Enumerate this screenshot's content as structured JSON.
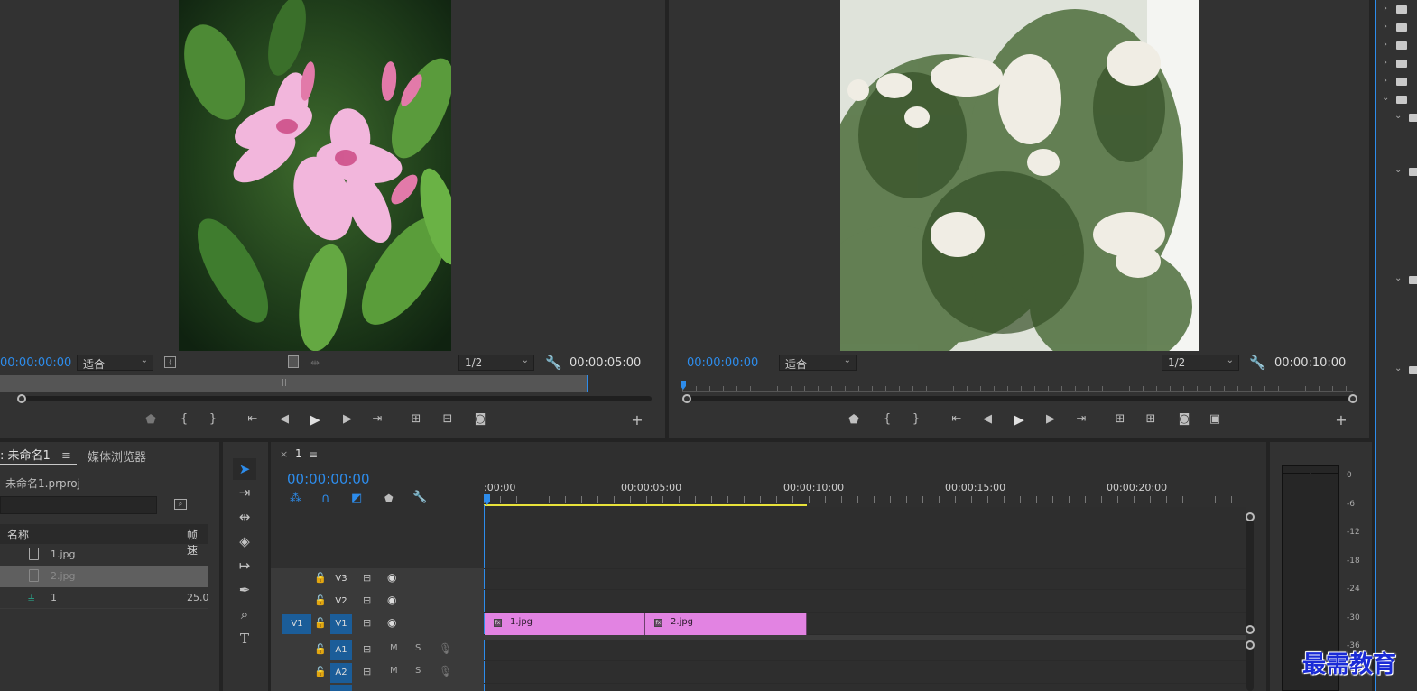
{
  "source_monitor": {
    "timecode_in": "00:00:00:00",
    "fit": "适合",
    "resolution": "1/2",
    "duration": "00:00:05:00",
    "playhead_fraction": 0.0
  },
  "program_monitor": {
    "timecode_in": "00:00:00:00",
    "fit": "适合",
    "resolution": "1/2",
    "duration": "00:00:10:00"
  },
  "project_panel": {
    "tab_project": ": 未命名1",
    "tab_media_browser": "媒体浏览器",
    "project_file": "未命名1.prproj",
    "col_name": "名称",
    "col_fps": "帧速",
    "items": [
      {
        "name": "1.jpg",
        "fps": "",
        "icon": "image-file-icon",
        "selected": false
      },
      {
        "name": "2.jpg",
        "fps": "",
        "icon": "image-file-icon",
        "selected": true
      },
      {
        "name": "1",
        "fps": "25.0",
        "icon": "sequence-icon",
        "selected": false
      }
    ]
  },
  "timeline": {
    "tab_name": "1",
    "timecode": "00:00:00:00",
    "ruler_labels": [
      ":00:00",
      "00:00:05:00",
      "00:00:10:00",
      "00:00:15:00",
      "00:00:20:00"
    ],
    "tracks_video": [
      {
        "source": "",
        "name": "V3"
      },
      {
        "source": "",
        "name": "V2"
      },
      {
        "source": "V1",
        "name": "V1"
      }
    ],
    "tracks_audio": [
      {
        "name": "A1",
        "m": "M",
        "s": "S"
      },
      {
        "name": "A2",
        "m": "M",
        "s": "S"
      }
    ],
    "clips": [
      {
        "name": "1.jpg"
      },
      {
        "name": "2.jpg"
      }
    ]
  },
  "audio_meter": {
    "labels": [
      "0",
      "-6",
      "-12",
      "-18",
      "-24",
      "-30",
      "-36"
    ]
  },
  "watermark": "最需教育",
  "colors": {
    "accent_blue": "#2d8ceb",
    "clip_pink": "#e283e2",
    "work_area_yellow": "#e8e23a",
    "panel_bg": "#323232"
  }
}
